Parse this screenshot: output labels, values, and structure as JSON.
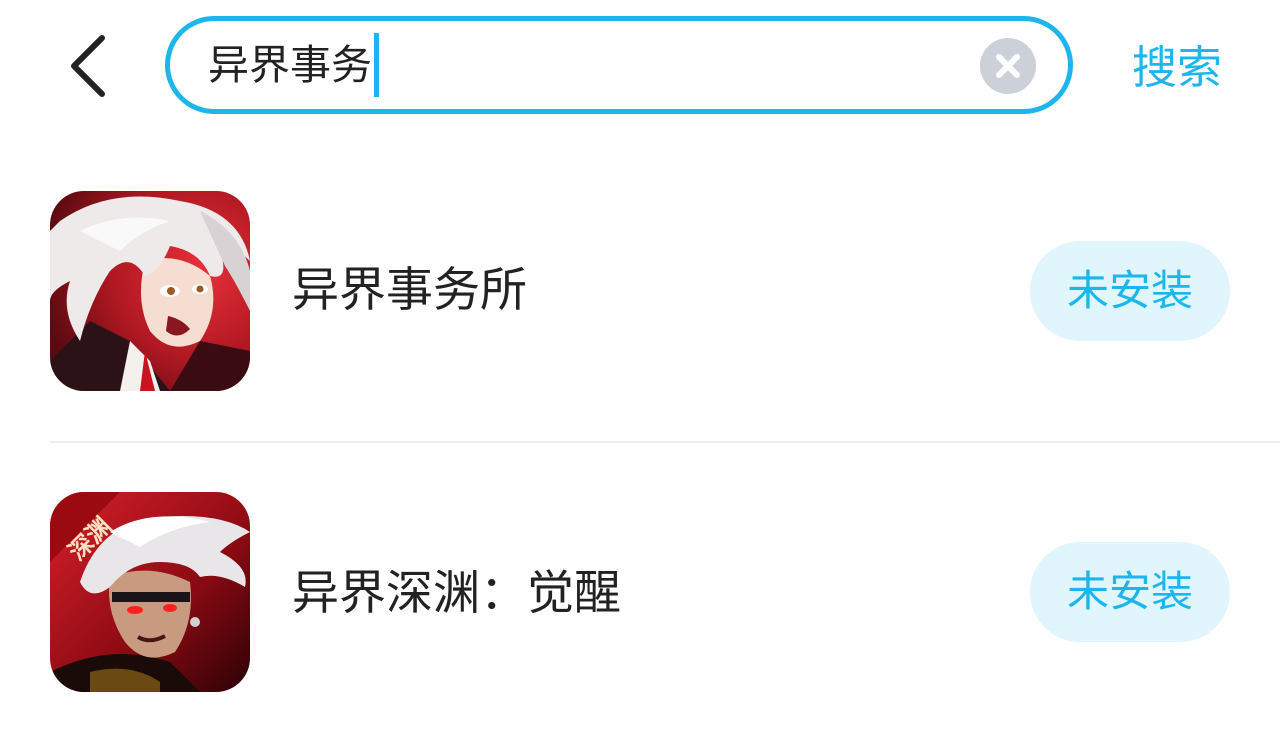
{
  "search": {
    "query": "异界事务",
    "submit_label": "搜索",
    "back_icon": "chevron-left-icon",
    "clear_icon": "clear-x-icon"
  },
  "results": [
    {
      "name": "异界事务所",
      "install_status": "未安装",
      "icon": "app-icon-white-haired-character"
    },
    {
      "name": "异界深渊：觉醒",
      "install_status": "未安装",
      "icon": "app-icon-white-haired-warrior",
      "icon_text": "深渊"
    }
  ],
  "colors": {
    "accent": "#1cb5ec",
    "install_bg": "#e0f5fc",
    "clear_bg": "#ccd0d8",
    "text": "#222222"
  }
}
